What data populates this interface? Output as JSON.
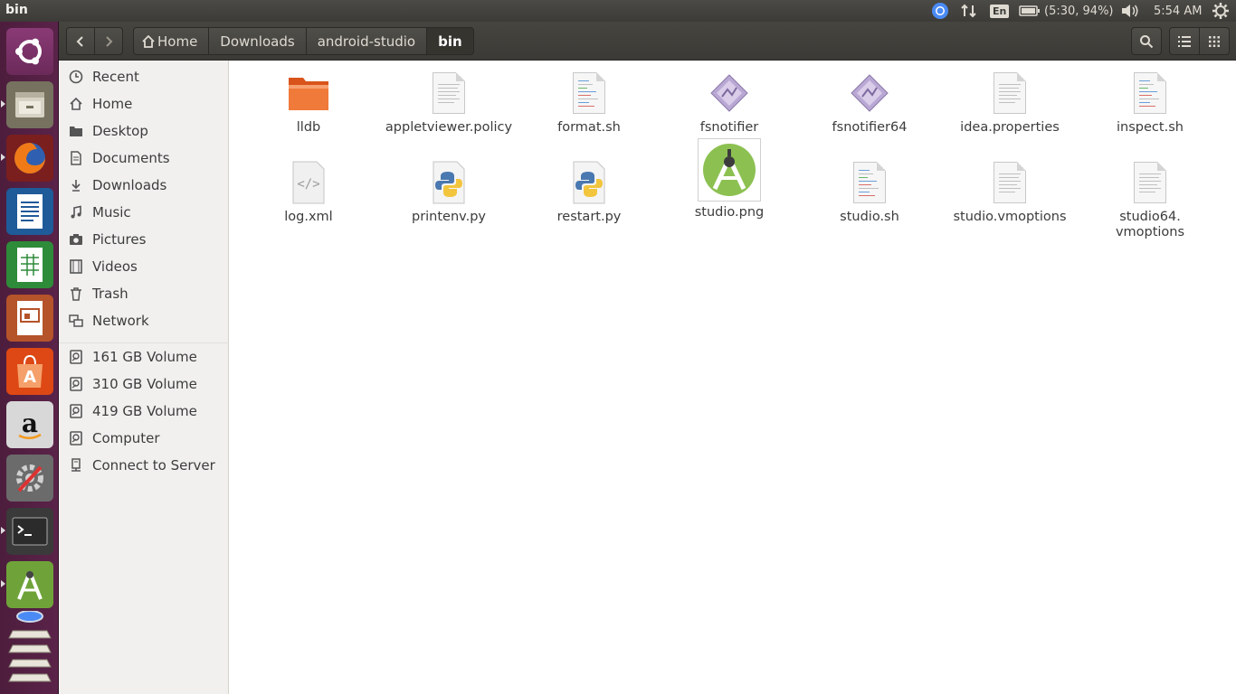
{
  "window": {
    "title": "bin"
  },
  "tray": {
    "language": "En",
    "battery": "(5:30, 94%)",
    "clock": "5:54 AM"
  },
  "launcher": {
    "items": [
      "ubuntu-dash",
      "files",
      "firefox",
      "libreoffice-writer",
      "libreoffice-calc",
      "libreoffice-impress",
      "ubuntu-software",
      "amazon",
      "system-settings",
      "terminal",
      "android-studio",
      "workspace-switcher"
    ]
  },
  "breadcrumb": [
    "Home",
    "Downloads",
    "android-studio",
    "bin"
  ],
  "sidebar": {
    "places": [
      "Recent",
      "Home",
      "Desktop",
      "Documents",
      "Downloads",
      "Music",
      "Pictures",
      "Videos",
      "Trash",
      "Network"
    ],
    "devices": [
      "161 GB Volume",
      "310 GB Volume",
      "419 GB Volume",
      "Computer",
      "Connect to Server"
    ]
  },
  "files": [
    {
      "name": "lldb",
      "type": "folder"
    },
    {
      "name": "appletviewer.policy",
      "type": "text"
    },
    {
      "name": "format.sh",
      "type": "script"
    },
    {
      "name": "fsnotifier",
      "type": "executable"
    },
    {
      "name": "fsnotifier64",
      "type": "executable"
    },
    {
      "name": "idea.properties",
      "type": "text"
    },
    {
      "name": "inspect.sh",
      "type": "script"
    },
    {
      "name": "log.xml",
      "type": "xml"
    },
    {
      "name": "printenv.py",
      "type": "python"
    },
    {
      "name": "restart.py",
      "type": "python"
    },
    {
      "name": "studio.png",
      "type": "image"
    },
    {
      "name": "studio.sh",
      "type": "script"
    },
    {
      "name": "studio.vmoptions",
      "type": "text"
    },
    {
      "name": "studio64.\nvmoptions",
      "type": "text"
    }
  ],
  "colors": {
    "launcher": "#5a2349",
    "folder": "#f0702c",
    "android": "#a4c639",
    "highlight": "#e95420"
  }
}
